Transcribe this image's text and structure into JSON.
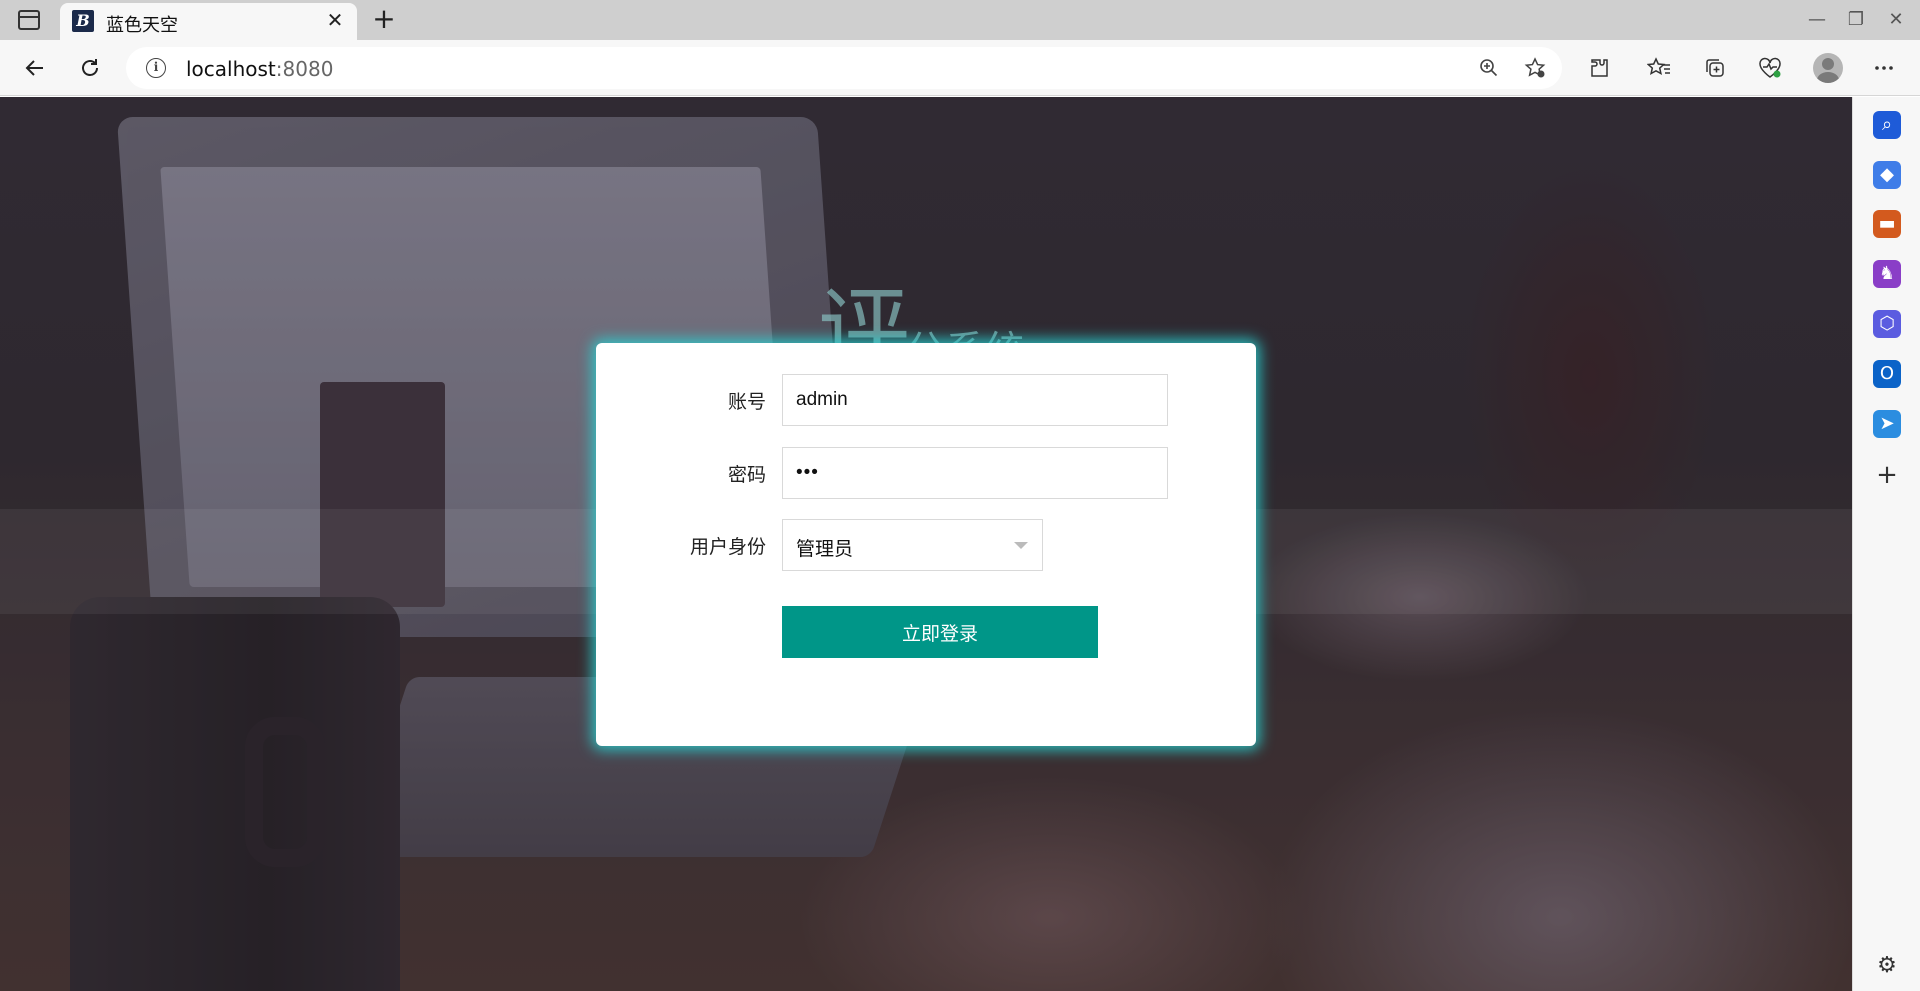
{
  "browser": {
    "tab": {
      "title": "蓝色天空",
      "favicon_text": "B",
      "close": "✕"
    },
    "new_tab": "+",
    "window_controls": {
      "minimize": "—",
      "restore": "❐",
      "close": "✕"
    },
    "address": {
      "host": "localhost",
      "port": ":8080"
    },
    "icons": {
      "back": "back-arrow-icon",
      "reload": "reload-icon",
      "info": "site-info-icon",
      "zoom": "zoom-icon",
      "favorite_add": "add-favorite-icon",
      "extensions": "extensions-icon",
      "favorites": "favorites-icon",
      "collections": "collections-icon",
      "health": "browser-essentials-icon",
      "profile": "profile-avatar-icon",
      "more": "more-menu-icon"
    }
  },
  "sidebar": {
    "items": [
      {
        "name": "search-icon",
        "color": "#1e5bd8",
        "glyph": "⌕"
      },
      {
        "name": "shopping-tag-icon",
        "color": "#3f7de8",
        "glyph": "◆"
      },
      {
        "name": "tools-icon",
        "color": "#d35a1e",
        "glyph": "▬"
      },
      {
        "name": "games-icon",
        "color": "#8a3ec7",
        "glyph": "♞"
      },
      {
        "name": "microsoft-365-icon",
        "color": "#5b5ce0",
        "glyph": "⬡"
      },
      {
        "name": "outlook-icon",
        "color": "#0b63c8",
        "glyph": "O"
      },
      {
        "name": "drop-send-icon",
        "color": "#2b8de0",
        "glyph": "➤"
      }
    ],
    "add": "+",
    "settings": "⚙"
  },
  "page": {
    "background_title": {
      "big": "评",
      "small": "分系统"
    },
    "login": {
      "account_label": "账号",
      "account_value": "admin",
      "password_label": "密码",
      "password_value": "•••",
      "role_label": "用户身份",
      "role_value": "管理员",
      "submit_label": "立即登录"
    }
  },
  "colors": {
    "primary": "#009688",
    "card_glow": "#28d2d2"
  }
}
